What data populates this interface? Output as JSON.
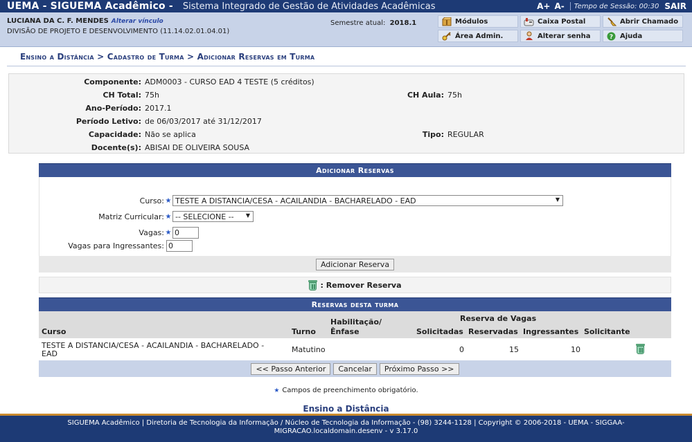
{
  "header": {
    "system_name": "UEMA - SIGUEMA Acadêmico -",
    "subsystem": "Sistema Integrado de Gestão de Atividades Acadêmicas",
    "font_increase": "A+",
    "font_decrease": "A-",
    "session_label": "Tempo de Sessão: 00:30",
    "logout": "SAIR"
  },
  "user": {
    "name": "LUCIANA DA C. F. MENDES",
    "change_link": "Alterar vínculo",
    "unit": "DIVISÃO DE PROJETO E DESENVOLVIMENTO (11.14.02.01.04.01)",
    "semester_label": "Semestre atual:",
    "semester_value": "2018.1"
  },
  "menu": {
    "modulos": "Módulos",
    "caixa_postal": "Caixa Postal",
    "abrir_chamado": "Abrir Chamado",
    "area_admin": "Área Admin.",
    "alterar_senha": "Alterar senha",
    "ajuda": "Ajuda"
  },
  "breadcrumb": "Ensino a Distância > Cadastro de Turma > Adicionar Reservas em Turma",
  "info": {
    "componente_label": "Componente:",
    "componente": "ADM0003 - CURSO EAD 4 TESTE (5 créditos)",
    "ch_total_label": "CH Total:",
    "ch_total": "75h",
    "ch_aula_label": "CH Aula:",
    "ch_aula": "75h",
    "ano_periodo_label": "Ano-Período:",
    "ano_periodo": "2017.1",
    "periodo_letivo_label": "Período Letivo:",
    "periodo_letivo": "de 06/03/2017 até 31/12/2017",
    "capacidade_label": "Capacidade:",
    "capacidade": "Não se aplica",
    "tipo_label": "Tipo:",
    "tipo": "REGULAR",
    "docentes_label": "Docente(s):",
    "docentes": "ABISAI DE OLIVEIRA SOUSA"
  },
  "form": {
    "title": "Adicionar Reservas",
    "curso_label": "Curso:",
    "curso_value": "TESTE A DISTANCIA/CESA - ACAILANDIA - BACHARELADO - EAD",
    "matriz_label": "Matriz Curricular:",
    "matriz_value": "-- SELECIONE --",
    "vagas_label": "Vagas:",
    "vagas_value": "0",
    "vagas_ingressantes_label": "Vagas para Ingressantes:",
    "vagas_ingressantes_value": "0",
    "submit": "Adicionar Reserva"
  },
  "legend": {
    "remove": ": Remover Reserva"
  },
  "reservations": {
    "title": "Reservas desta turma",
    "col_curso": "Curso",
    "col_turno": "Turno",
    "col_habilitacao_1": "Habilitação/",
    "col_habilitacao_2": "Ênfase",
    "col_group": "Reserva de Vagas",
    "col_solicitadas": "Solicitadas",
    "col_reservadas": "Reservadas",
    "col_ingressantes": "Ingressantes",
    "col_solicitante": "Solicitante",
    "rows": [
      {
        "curso_1": "TESTE A DISTANCIA/CESA - ACAILANDIA - BACHARELADO -",
        "curso_2": "EAD",
        "turno": "Matutino",
        "habilitacao": "",
        "solicitadas": "0",
        "reservadas": "15",
        "ingressantes": "10",
        "solicitante": ""
      }
    ],
    "btn_prev": "<< Passo Anterior",
    "btn_cancel": "Cancelar",
    "btn_next": "Próximo Passo >>"
  },
  "hint": "Campos de preenchimento obrigatório.",
  "home_link": "Ensino a Distância",
  "footer": {
    "line1": "SIGUEMA Acadêmico | Diretoria de Tecnologia da Informação / Núcleo de Tecnologia da Informação - (98) 3244-1128 | Copyright © 2006-2018 - UEMA - SIGGAA-",
    "line2": "MIGRACAO.localdomain.desenv - v 3.17.0"
  },
  "colors": {
    "top_bar": "#1d3a75",
    "info_bar": "#c8d3e8",
    "caption": "#3b5595",
    "required_star": "#2a59c6",
    "footer_border": "#c98a2e"
  }
}
